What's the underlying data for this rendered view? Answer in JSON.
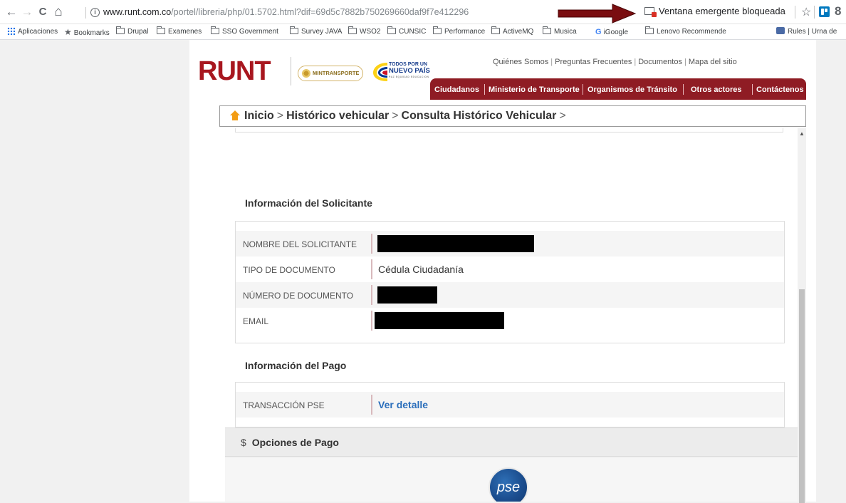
{
  "browser": {
    "url_domain": "www.runt.com.co",
    "url_path": "/portel/libreria/php/01.5702.html?dif=69d5c7882b750269660daf9f7e412296",
    "popup_blocked": "Ventana emergente bloqueada",
    "nav_back": "←",
    "nav_forward": "→",
    "nav_reload": "C",
    "nav_home": "⌂",
    "info": "i",
    "star": "☆",
    "more": "8"
  },
  "bookmarks": [
    {
      "label": "Aplicaciones",
      "icon": "apps-icon"
    },
    {
      "label": "Bookmarks",
      "icon": "star-icon"
    },
    {
      "label": "Drupal",
      "icon": "folder-icon"
    },
    {
      "label": "Examenes",
      "icon": "folder-icon"
    },
    {
      "label": "SSO Government",
      "icon": "folder-icon"
    },
    {
      "label": "Survey JAVA",
      "icon": "folder-icon"
    },
    {
      "label": "WSO2",
      "icon": "folder-icon"
    },
    {
      "label": "CUNSIC",
      "icon": "folder-icon"
    },
    {
      "label": "Performance",
      "icon": "folder-icon"
    },
    {
      "label": "ActiveMQ",
      "icon": "folder-icon"
    },
    {
      "label": "Musica",
      "icon": "folder-icon"
    },
    {
      "label": "iGoogle",
      "icon": "google-icon"
    },
    {
      "label": "Lenovo Recommende",
      "icon": "folder-icon"
    },
    {
      "label": "Rules | Urna de",
      "icon": "rules-icon"
    }
  ],
  "header": {
    "logo_runt": "RUNT",
    "logo_mintransporte": "MINTRANSPORTE",
    "logo_tpun_line1": "TODOS POR UN",
    "logo_tpun_line2": "NUEVO PAÍS",
    "logo_tpun_line3": "PAZ EQUIDAD EDUCACION",
    "top_links": [
      "Quiénes Somos",
      "Preguntas Frecuentes",
      "Documentos",
      "Mapa del sitio"
    ],
    "main_nav": [
      "Ciudadanos",
      "Ministerio de Transporte",
      "Organismos de Tránsito",
      "Otros actores",
      "Contáctenos"
    ]
  },
  "breadcrumb": {
    "items": [
      "Inicio",
      "Histórico vehicular",
      "Consulta Histórico Vehicular"
    ],
    "sep": ">"
  },
  "solicitante": {
    "title": "Información del Solicitante",
    "rows": [
      {
        "label": "NOMBRE DEL SOLICITANTE",
        "value": ""
      },
      {
        "label": "TIPO DE DOCUMENTO",
        "value": "Cédula Ciudadanía"
      },
      {
        "label": "NÚMERO DE DOCUMENTO",
        "value": ""
      },
      {
        "label": "EMAIL",
        "value": ""
      }
    ]
  },
  "pago": {
    "title": "Información del Pago",
    "rows": [
      {
        "label": "TRANSACCIÓN PSE",
        "value": "Ver detalle"
      }
    ]
  },
  "opciones_pago": {
    "symbol": "$",
    "title": "Opciones de Pago",
    "pse_label": "pse"
  },
  "colors": {
    "brand_red": "#8f1c24",
    "link_blue": "#2a6ebb",
    "home_orange": "#f39c12"
  }
}
